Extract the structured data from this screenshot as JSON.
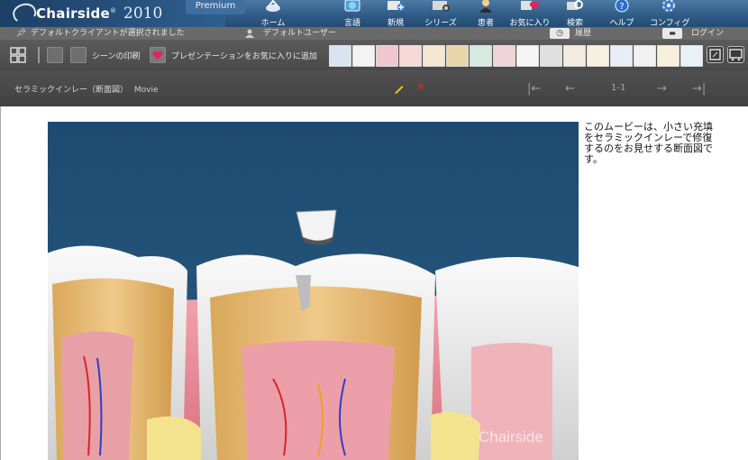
{
  "header": {
    "logo_text": "Chairside",
    "logo_year": "2010",
    "edition": "Premium",
    "nav": [
      {
        "label": "ホーム",
        "icon": "home-icon"
      },
      {
        "label": "言語",
        "icon": "globe-icon"
      },
      {
        "label": "新規",
        "icon": "new-icon"
      },
      {
        "label": "シリーズ",
        "icon": "series-icon"
      },
      {
        "label": "患者",
        "icon": "patient-icon"
      },
      {
        "label": "お気に入り",
        "icon": "favorites-icon"
      },
      {
        "label": "検索",
        "icon": "search-icon"
      },
      {
        "label": "ヘルプ",
        "icon": "help-icon"
      },
      {
        "label": "コンフィグ",
        "icon": "config-icon"
      }
    ]
  },
  "status": {
    "client": "デフォルトクライアントが選択されました",
    "user": "デフォルトユーザー",
    "history": "履歴",
    "login": "ログイン"
  },
  "toolbar": {
    "print_scene": "シーンの印刷",
    "add_favorite": "プレゼンテーションをお気に入りに追加",
    "thumb_count": 16
  },
  "movie": {
    "title": "セラミックインレー（断面図）",
    "kind": "Movie",
    "counter": "1-1",
    "watermark": "Chairside",
    "description": "このムービーは、小さい充填をセラミックインレーで修復するのをお見せする断面図です。"
  },
  "colors": {
    "accent": "#2d5a85",
    "toolbar": "#4a4a4a",
    "frame_bg": "#1f4f74"
  }
}
